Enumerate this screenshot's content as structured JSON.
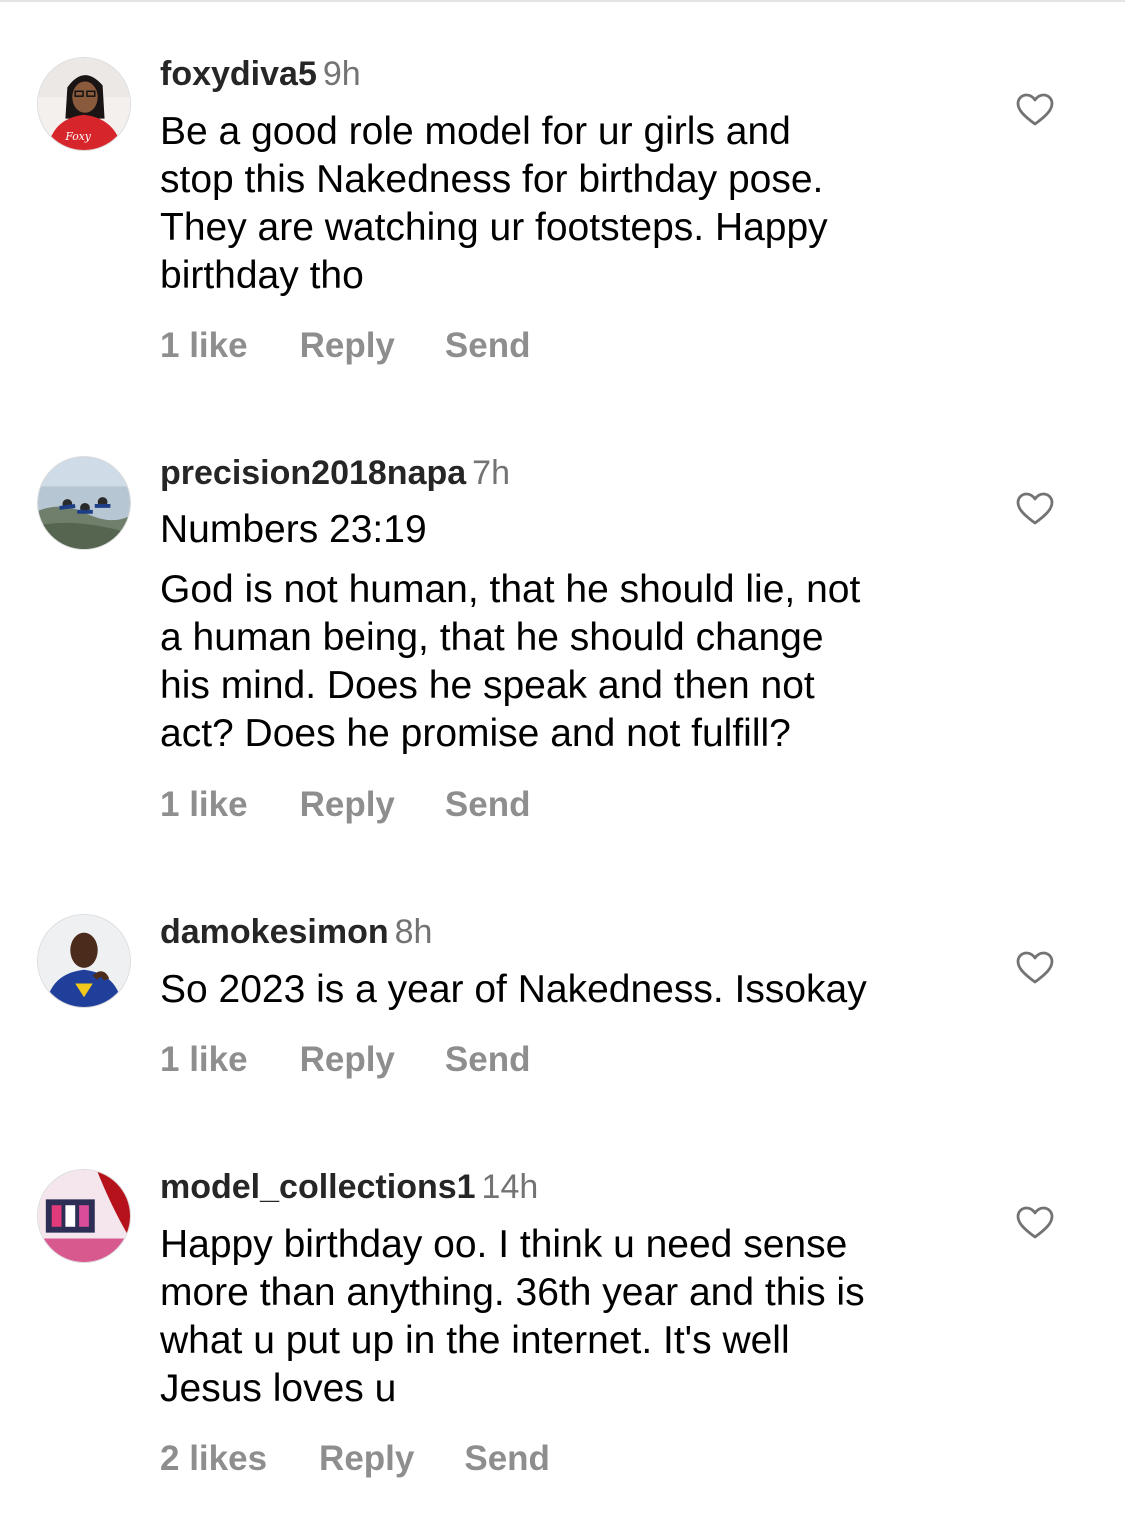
{
  "comments": [
    {
      "username": "foxydiva5",
      "time": "9h",
      "paragraphs": [
        "Be a good role model for ur girls and\nstop this Nakedness for birthday pose.\nThey are watching ur footsteps. Happy\nbirthday tho"
      ],
      "likes": "1 like",
      "reply": "Reply",
      "send": "Send",
      "like_icon": "heart-outline-icon"
    },
    {
      "username": "precision2018napa",
      "time": "7h",
      "paragraphs": [
        "Numbers 23:19",
        "God is not human, that he should lie, not\na human being, that he should change\nhis mind. Does he speak and then not\nact? Does he promise and not fulfill?"
      ],
      "likes": "1 like",
      "reply": "Reply",
      "send": "Send",
      "like_icon": "heart-outline-icon"
    },
    {
      "username": "damokesimon",
      "time": "8h",
      "paragraphs": [
        "So 2023 is a year of Nakedness. Issokay"
      ],
      "likes": "1 like",
      "reply": "Reply",
      "send": "Send",
      "like_icon": "heart-outline-icon"
    },
    {
      "username": "model_collections1",
      "time": "14h",
      "paragraphs": [
        "Happy birthday oo. I think u need sense\nmore than anything. 36th year and this is\nwhat u put up in the internet. It's well\nJesus loves u"
      ],
      "likes": "2 likes",
      "reply": "Reply",
      "send": "Send",
      "like_icon": "heart-outline-icon"
    }
  ]
}
